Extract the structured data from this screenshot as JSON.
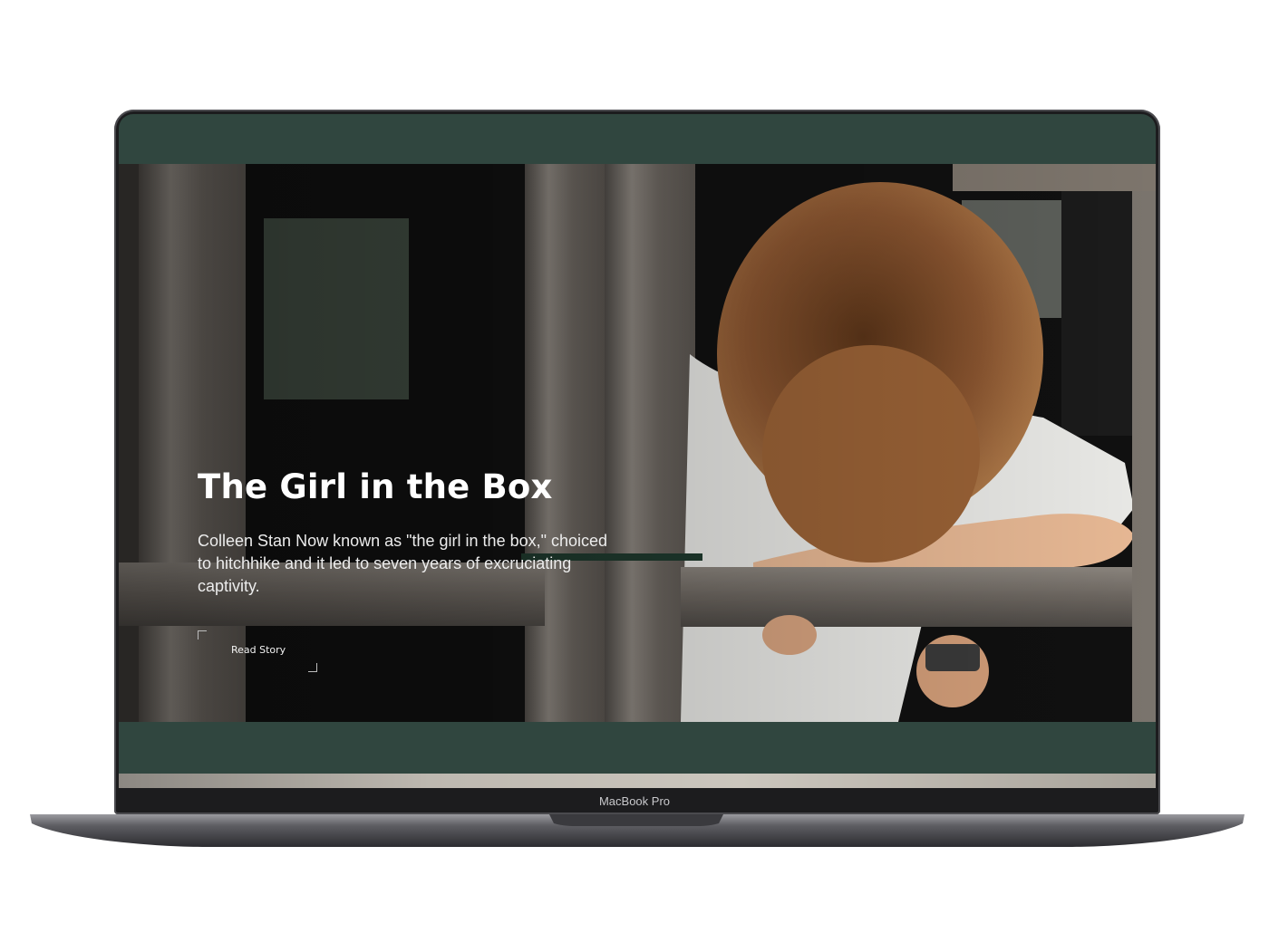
{
  "hero": {
    "title": "The Girl in the Box",
    "description": "Colleen Stan Now known as \"the girl in the box,\" choiced to hitchhike and it led to seven years of excruciating captivity.",
    "read_label": "Read Story"
  },
  "device": {
    "label": "MacBook Pro"
  },
  "colors": {
    "screen_background": "#30463f",
    "hair": "#8a5530",
    "wood": "#6f6a64"
  }
}
